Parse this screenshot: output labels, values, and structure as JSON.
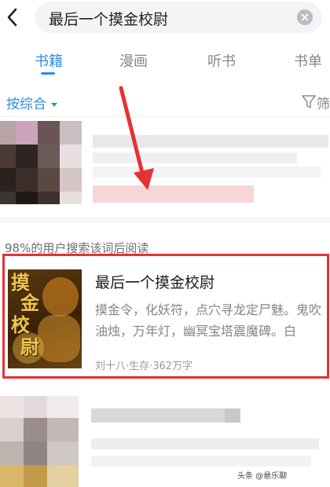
{
  "search": {
    "query": "最后一个摸金校尉"
  },
  "tabs": [
    {
      "label": "书籍",
      "active": true
    },
    {
      "label": "漫画",
      "active": false
    },
    {
      "label": "听书",
      "active": false
    },
    {
      "label": "书单",
      "active": false
    }
  ],
  "sort": {
    "label": "按综合",
    "filter_label": "筛"
  },
  "hint": "98%的用户搜索该词后阅读",
  "book": {
    "title": "最后一个摸金校尉",
    "description": "摸金令，化妖符，点穴寻龙定尸魅。鬼吹油烛，万年灯，幽冥宝塔震魔碑。白",
    "meta": "刘十八·生存·362万字",
    "cover_text_1": "摸",
    "cover_text_2": "金",
    "cover_text_3": "校",
    "cover_text_4": "尉"
  },
  "watermark": "头条 @悬乐聊",
  "colors": {
    "accent": "#2e8be6",
    "highlight": "#e63135",
    "arrow": "#e63135"
  },
  "icons": {
    "back": "chevron-left-icon",
    "clear": "close-circle-icon",
    "filter": "funnel-icon"
  }
}
